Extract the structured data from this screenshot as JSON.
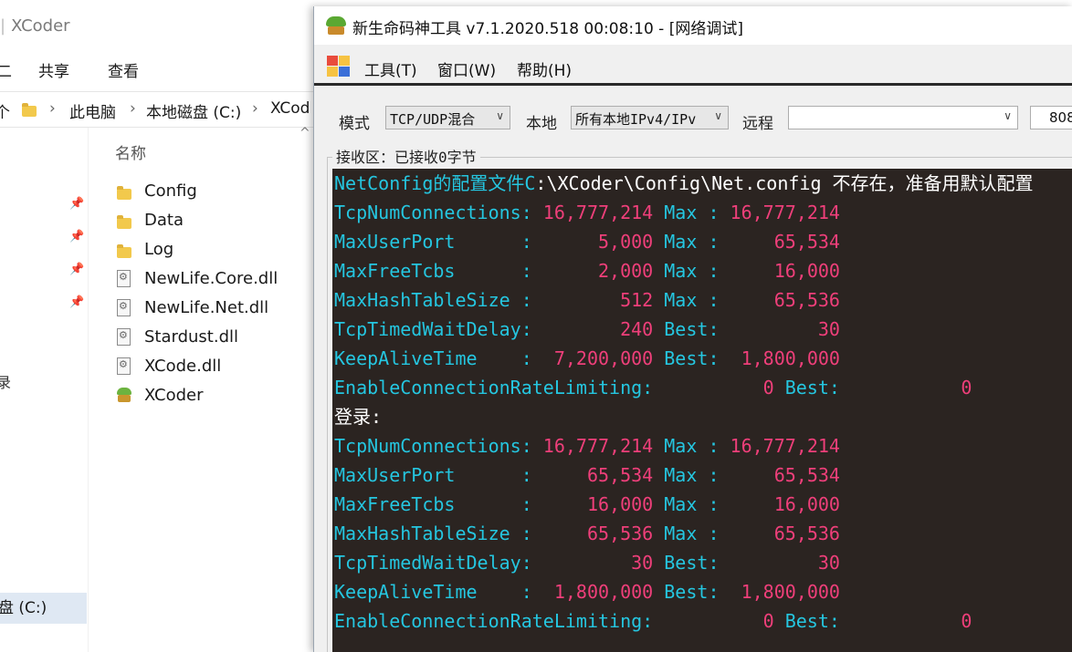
{
  "explorer": {
    "title": "XCoder",
    "ribbon": {
      "partial_tab": "二",
      "share": "共享",
      "view": "查看"
    },
    "address": {
      "partial": "个",
      "this_pc": "此电脑",
      "drive": "本地磁盘 (C:)",
      "folder": "XCod"
    },
    "nav": {
      "partial_item": "录",
      "drive_item": "盘 (C:)"
    },
    "column_header": "名称",
    "files": [
      {
        "name": "Config",
        "icon": "folder-icon"
      },
      {
        "name": "Data",
        "icon": "folder-icon"
      },
      {
        "name": "Log",
        "icon": "folder-icon"
      },
      {
        "name": "NewLife.Core.dll",
        "icon": "dll-icon"
      },
      {
        "name": "NewLife.Net.dll",
        "icon": "dll-icon"
      },
      {
        "name": "Stardust.dll",
        "icon": "dll-icon"
      },
      {
        "name": "XCode.dll",
        "icon": "dll-icon"
      },
      {
        "name": "XCoder",
        "icon": "xcoder-app-icon"
      }
    ]
  },
  "tool": {
    "title": "新生命码神工具 v7.1.2020.518 00:08:10 - [网络调试]",
    "menu": {
      "tools": "工具(T)",
      "window": "窗口(W)",
      "help": "帮助(H)"
    },
    "config": {
      "mode_label": "模式",
      "mode_value": "TCP/UDP混合",
      "local_label": "本地",
      "local_value": "所有本地IPv4/IPv",
      "remote_label": "远程",
      "remote_value": "",
      "port_value": "808"
    },
    "receive_label": "接收区：已接收0字节",
    "console": {
      "colors": {
        "background": "#2b2421",
        "key": "#25c6e0",
        "number": "#ef3f7a",
        "plain": "#ffffff"
      },
      "lines": [
        {
          "k": "NetConfig的配置文件C",
          "t1": ":\\XCoder\\Config\\Net.config 不存在，准备用默认配置"
        },
        {
          "k": "TcpNumConnections",
          "s1": ": ",
          "v1": "16,777,214",
          "m": " Max ",
          "s2": ": ",
          "v2": "16,777,214"
        },
        {
          "k": "MaxUserPort      ",
          "s1": ": ",
          "v1": "     5,000",
          "m": " Max ",
          "s2": ": ",
          "v2": "    65,534"
        },
        {
          "k": "MaxFreeTcbs      ",
          "s1": ": ",
          "v1": "     2,000",
          "m": " Max ",
          "s2": ": ",
          "v2": "    16,000"
        },
        {
          "k": "MaxHashTableSize ",
          "s1": ": ",
          "v1": "       512",
          "m": " Max ",
          "s2": ": ",
          "v2": "    65,536"
        },
        {
          "k": "TcpTimedWaitDelay",
          "s1": ": ",
          "v1": "       240",
          "m": " Best",
          "s2": ": ",
          "v2": "        30"
        },
        {
          "k": "KeepAliveTime    ",
          "s1": ": ",
          "v1": " 7,200,000",
          "m": " Best",
          "s2": ": ",
          "v2": " 1,800,000"
        },
        {
          "k": "EnableConnectionRateLimiting",
          "s1": ": ",
          "v1": "         0",
          "m": " Best",
          "s2": ":  ",
          "v2": "         0"
        },
        {
          "w": "登录:"
        },
        {
          "k": "TcpNumConnections",
          "s1": ": ",
          "v1": "16,777,214",
          "m": " Max ",
          "s2": ": ",
          "v2": "16,777,214"
        },
        {
          "k": "MaxUserPort      ",
          "s1": ": ",
          "v1": "    65,534",
          "m": " Max ",
          "s2": ": ",
          "v2": "    65,534"
        },
        {
          "k": "MaxFreeTcbs      ",
          "s1": ": ",
          "v1": "    16,000",
          "m": " Max ",
          "s2": ": ",
          "v2": "    16,000"
        },
        {
          "k": "MaxHashTableSize ",
          "s1": ": ",
          "v1": "    65,536",
          "m": " Max ",
          "s2": ": ",
          "v2": "    65,536"
        },
        {
          "k": "TcpTimedWaitDelay",
          "s1": ": ",
          "v1": "        30",
          "m": " Best",
          "s2": ": ",
          "v2": "        30"
        },
        {
          "k": "KeepAliveTime    ",
          "s1": ": ",
          "v1": " 1,800,000",
          "m": " Best",
          "s2": ": ",
          "v2": " 1,800,000"
        },
        {
          "k": "EnableConnectionRateLimiting",
          "s1": ": ",
          "v1": "         0",
          "m": " Best",
          "s2": ":  ",
          "v2": "         0"
        }
      ]
    }
  }
}
